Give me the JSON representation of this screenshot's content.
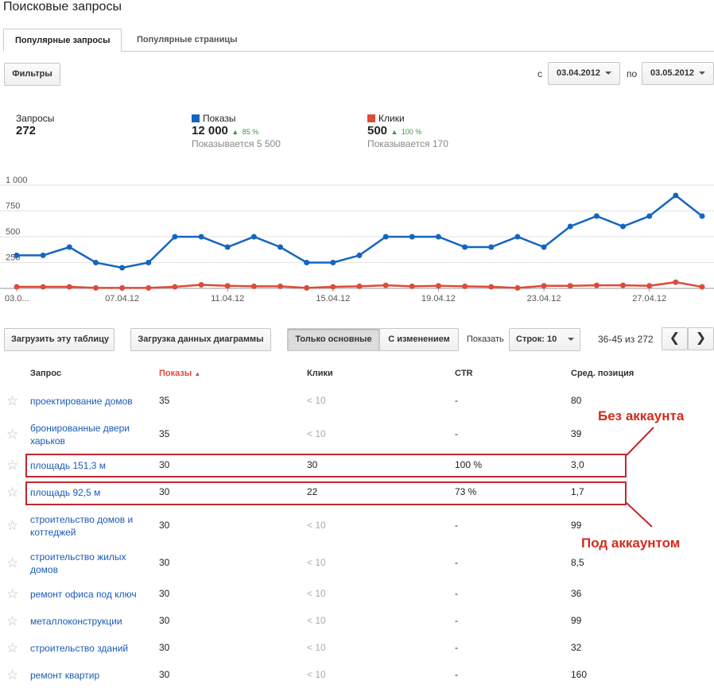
{
  "page": {
    "title": "Поисковые запросы"
  },
  "tabs": [
    {
      "label": "Популярные запросы",
      "active": true
    },
    {
      "label": "Популярные страницы",
      "active": false
    }
  ],
  "filters_label": "Фильтры",
  "date_range": {
    "from_prefix": "с",
    "from": "03.04.2012",
    "to_prefix": "по",
    "to": "03.05.2012"
  },
  "stats": {
    "queries": {
      "label": "Запросы",
      "value": "272"
    },
    "impressions": {
      "label": "Показы",
      "value": "12 000",
      "change": "85 %",
      "sub": "Показывается 5 500",
      "color": "#1565c0"
    },
    "clicks": {
      "label": "Клики",
      "value": "500",
      "change": "100 %",
      "sub": "Показывается 170",
      "color": "#dd4b39"
    }
  },
  "chart_data": {
    "type": "line",
    "y_ticks": [
      "1 000",
      "750",
      "500",
      "250"
    ],
    "ylim": [
      0,
      1000
    ],
    "x_tick_labels": [
      "03.0...",
      "07.04.12",
      "11.04.12",
      "15.04.12",
      "19.04.12",
      "23.04.12",
      "27.04.12"
    ],
    "series": [
      {
        "name": "Показы",
        "color": "#1565c0",
        "values": [
          320,
          320,
          400,
          250,
          200,
          250,
          500,
          500,
          400,
          500,
          400,
          250,
          250,
          320,
          500,
          500,
          500,
          400,
          400,
          500,
          400,
          600,
          700,
          600,
          700,
          900,
          700
        ]
      },
      {
        "name": "Клики",
        "color": "#dd4b39",
        "values": [
          15,
          15,
          15,
          5,
          5,
          5,
          15,
          35,
          25,
          20,
          20,
          5,
          15,
          20,
          30,
          20,
          25,
          20,
          15,
          5,
          25,
          25,
          30,
          30,
          25,
          60,
          15
        ]
      }
    ],
    "grid": true
  },
  "toolbar": {
    "download_table": "Загрузить эту таблицу",
    "download_chart": "Загрузка данных диаграммы",
    "only_basic": "Только основные",
    "with_change": "С изменением",
    "show_label": "Показать",
    "rows_select": "Строк: 10",
    "pagination": "36-45 из 272"
  },
  "table": {
    "columns": [
      "Запрос",
      "Показы",
      "Клики",
      "CTR",
      "Сред. позиция"
    ],
    "rows": [
      {
        "query": "проектирование домов",
        "impressions": "35",
        "clicks": "< 10",
        "ctr": "-",
        "position": "80"
      },
      {
        "query": "бронированные двери харьков",
        "impressions": "35",
        "clicks": "< 10",
        "ctr": "-",
        "position": "39"
      },
      {
        "query": "площадь 151,3 м",
        "impressions": "30",
        "clicks": "30",
        "ctr": "100 %",
        "position": "3,0"
      },
      {
        "query": "площадь 92,5 м",
        "impressions": "30",
        "clicks": "22",
        "ctr": "73 %",
        "position": "1,7"
      },
      {
        "query": "строительство домов и коттеджей",
        "impressions": "30",
        "clicks": "< 10",
        "ctr": "-",
        "position": "99"
      },
      {
        "query": "строительство жилых домов",
        "impressions": "30",
        "clicks": "< 10",
        "ctr": "-",
        "position": "8,5"
      },
      {
        "query": "ремонт офиса под ключ",
        "impressions": "30",
        "clicks": "< 10",
        "ctr": "-",
        "position": "36"
      },
      {
        "query": "металлоконструкции",
        "impressions": "30",
        "clicks": "< 10",
        "ctr": "-",
        "position": "99"
      },
      {
        "query": "строительство зданий",
        "impressions": "30",
        "clicks": "< 10",
        "ctr": "-",
        "position": "32"
      },
      {
        "query": "ремонт квартир",
        "impressions": "30",
        "clicks": "< 10",
        "ctr": "-",
        "position": "160"
      }
    ]
  },
  "annotations": {
    "without_account": "Без аккаунта",
    "with_account": "Под аккаунтом"
  }
}
